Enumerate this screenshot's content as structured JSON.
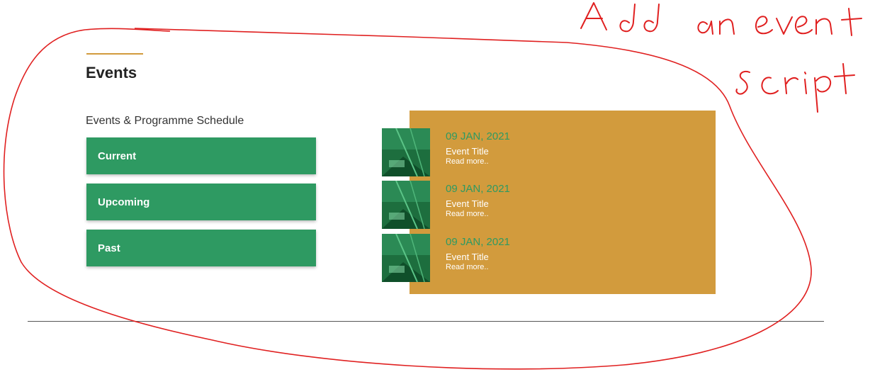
{
  "section": {
    "title": "Events",
    "subtitle": "Events & Programme Schedule",
    "accent_color": "#d29b3d"
  },
  "tabs": [
    {
      "label": "Current"
    },
    {
      "label": "Upcoming"
    },
    {
      "label": "Past"
    }
  ],
  "events": [
    {
      "date": "09 JAN, 2021",
      "title": "Event Title",
      "read_more": "Read more.."
    },
    {
      "date": "09 JAN, 2021",
      "title": "Event Title",
      "read_more": "Read more.."
    },
    {
      "date": "09 JAN, 2021",
      "title": "Event Title",
      "read_more": "Read more.."
    }
  ],
  "annotation": {
    "text": "Add an event script",
    "color": "#e02020"
  },
  "colors": {
    "button_green": "#2e9a62",
    "panel_gold": "#d29b3d",
    "date_green": "#2e9a62"
  }
}
